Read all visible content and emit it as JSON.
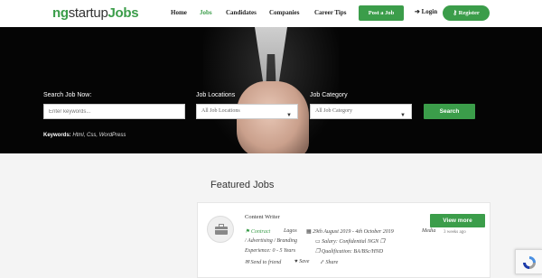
{
  "header": {
    "logo": {
      "part1": "ng",
      "part2": "startup",
      "part3": "Jobs"
    },
    "nav": [
      "Home",
      "Jobs",
      "Candidates",
      "Companies",
      "Career Tips"
    ],
    "active_nav": "Jobs",
    "post_job": "Post a Job",
    "login": "Login",
    "register": "Register"
  },
  "search": {
    "job_label": "Search Job Now:",
    "job_placeholder": "Enter keywords...",
    "location_label": "Job Locations",
    "location_selected": "All Job Locations",
    "category_label": "Job Category",
    "category_selected": "All Job Category",
    "button": "Search",
    "keywords_label": "Keywords:",
    "keywords_value": "Html, Css, WordPress"
  },
  "featured": {
    "title": "Featured Jobs",
    "job": {
      "title": "Content Writer",
      "type": "Contract",
      "location": "Lagos",
      "dates": "29th August 2019 - 4th October 2019",
      "category_a": "Media",
      "category_b": "/ Advertising / Branding",
      "salary": "Salary: Confidential NGN",
      "experience": "Experience: 0 - 5 Years",
      "qualification": "Qualification: BA/BSc/HND",
      "send": "Send to friend",
      "save": "Save",
      "share": "Share",
      "view_more": "View more",
      "posted": "3 weeks ago"
    }
  },
  "colors": {
    "accent": "#3b9d4a",
    "hero_bg": "#050505"
  },
  "icons": [
    "briefcase-icon",
    "calendar-icon",
    "money-icon",
    "flag-icon",
    "login-icon",
    "key-icon",
    "mail-icon",
    "heart-icon",
    "share-icon",
    "recaptcha-icon",
    "chevron-down-icon"
  ]
}
